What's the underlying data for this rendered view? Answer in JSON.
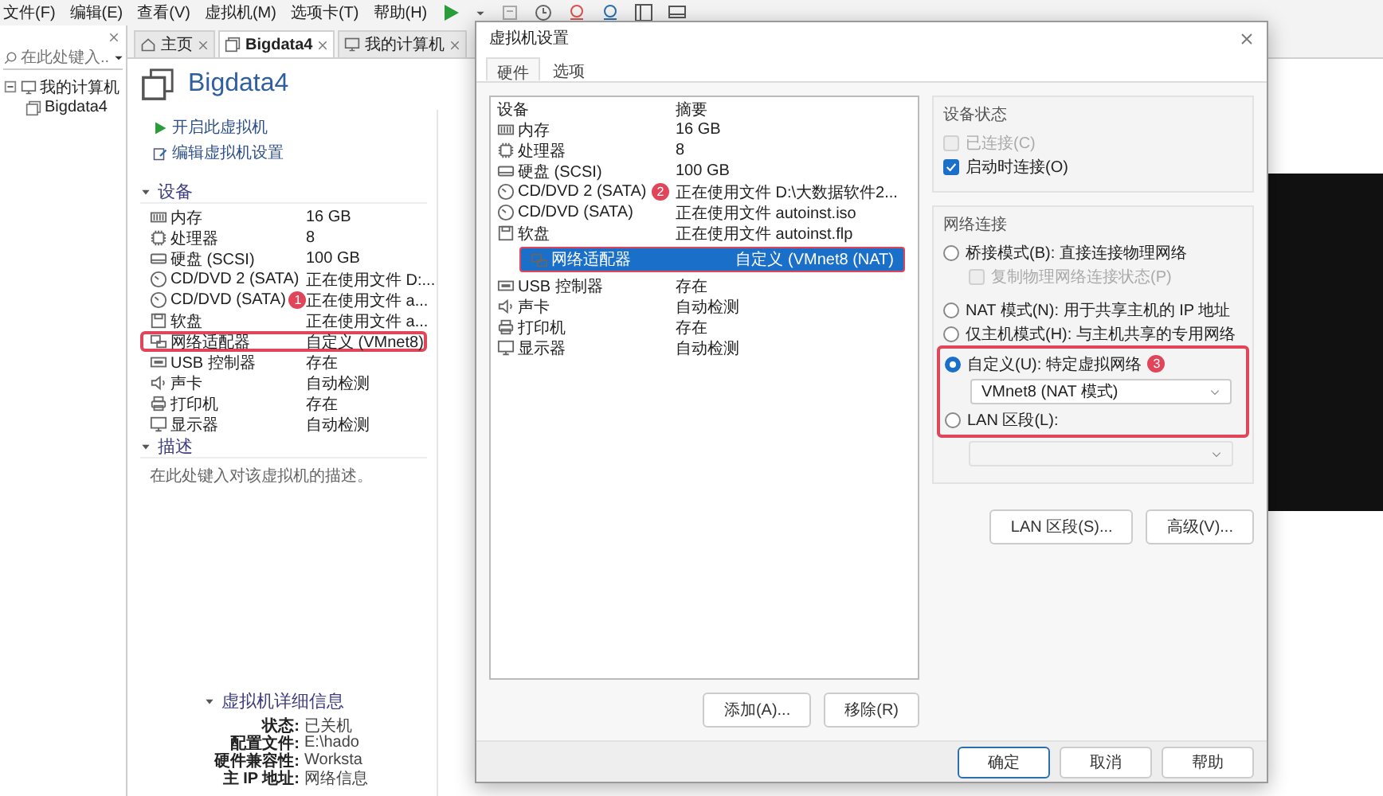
{
  "menu": [
    "文件(F)",
    "编辑(E)",
    "查看(V)",
    "虚拟机(M)",
    "选项卡(T)",
    "帮助(H)"
  ],
  "library": {
    "search_placeholder": "在此处键入...",
    "tree": [
      {
        "label": "我的计算机",
        "expanded": true,
        "children": [
          {
            "label": "Bigdata4"
          }
        ]
      }
    ]
  },
  "tabs": [
    {
      "kind": "home",
      "label": "主页",
      "selected": false
    },
    {
      "kind": "vm",
      "label": "Bigdata4",
      "selected": true
    },
    {
      "kind": "host",
      "label": "我的计算机",
      "selected": false
    }
  ],
  "vm": {
    "title": "Bigdata4",
    "actions": [
      {
        "kind": "power_on",
        "label": "开启此虚拟机"
      },
      {
        "kind": "edit",
        "label": "编辑虚拟机设置"
      }
    ],
    "devices_section": {
      "heading": "设备",
      "expanded": true,
      "rows": [
        {
          "kind": "memory",
          "name": "内存",
          "summary": "16 GB",
          "highlighted": false
        },
        {
          "kind": "cpu",
          "name": "处理器",
          "summary": "8",
          "highlighted": false
        },
        {
          "kind": "disk",
          "name": "硬盘 (SCSI)",
          "summary": "100 GB",
          "highlighted": false
        },
        {
          "kind": "cd",
          "name": "CD/DVD 2 (SATA)",
          "summary": "正在使用文件 D:...",
          "highlighted": false
        },
        {
          "kind": "cd",
          "name": "CD/DVD (SATA)",
          "summary": "正在使用文件 a...",
          "highlighted": false,
          "badge": "1"
        },
        {
          "kind": "floppy",
          "name": "软盘",
          "summary": "正在使用文件 a...",
          "highlighted": false
        },
        {
          "kind": "network",
          "name": "网络适配器",
          "summary": "自定义 (VMnet8)",
          "highlighted": true
        },
        {
          "kind": "usb",
          "name": "USB 控制器",
          "summary": "存在",
          "highlighted": false
        },
        {
          "kind": "sound",
          "name": "声卡",
          "summary": "自动检测",
          "highlighted": false
        },
        {
          "kind": "printer",
          "name": "打印机",
          "summary": "存在",
          "highlighted": false
        },
        {
          "kind": "display",
          "name": "显示器",
          "summary": "自动检测",
          "highlighted": false
        }
      ]
    },
    "description_section": {
      "heading": "描述",
      "expanded": true,
      "placeholder": "在此处键入对该虚拟机的描述。"
    },
    "details_section": {
      "heading": "虚拟机详细信息",
      "expanded": true,
      "rows": [
        {
          "label": "状态:",
          "value": "已关机"
        },
        {
          "label": "配置文件:",
          "value": "E:\\hado"
        },
        {
          "label": "硬件兼容性:",
          "value": "Worksta"
        },
        {
          "label": "主 IP 地址:",
          "value": "网络信息"
        }
      ]
    }
  },
  "dialog": {
    "title": "虚拟机设置",
    "tabs": [
      {
        "label": "硬件",
        "selected": true
      },
      {
        "label": "选项",
        "selected": false
      }
    ],
    "devices": {
      "columns": [
        "设备",
        "摘要"
      ],
      "rows": [
        {
          "kind": "memory",
          "name": "内存",
          "summary": "16 GB",
          "selected": false,
          "highlighted": false
        },
        {
          "kind": "cpu",
          "name": "处理器",
          "summary": "8",
          "selected": false,
          "highlighted": false
        },
        {
          "kind": "disk",
          "name": "硬盘 (SCSI)",
          "summary": "100 GB",
          "selected": false,
          "highlighted": false
        },
        {
          "kind": "cd",
          "name": "CD/DVD 2 (SATA)",
          "summary": "正在使用文件 D:\\大数据软件2...",
          "selected": false,
          "highlighted": false,
          "badge": "2"
        },
        {
          "kind": "cd",
          "name": "CD/DVD (SATA)",
          "summary": "正在使用文件 autoinst.iso",
          "selected": false,
          "highlighted": false
        },
        {
          "kind": "floppy",
          "name": "软盘",
          "summary": "正在使用文件 autoinst.flp",
          "selected": false,
          "highlighted": false
        },
        {
          "kind": "network",
          "name": "网络适配器",
          "summary": "自定义 (VMnet8 (NAT)",
          "selected": true,
          "highlighted": true
        },
        {
          "kind": "usb",
          "name": "USB 控制器",
          "summary": "存在",
          "selected": false,
          "highlighted": false
        },
        {
          "kind": "sound",
          "name": "声卡",
          "summary": "自动检测",
          "selected": false,
          "highlighted": false
        },
        {
          "kind": "printer",
          "name": "打印机",
          "summary": "存在",
          "selected": false,
          "highlighted": false
        },
        {
          "kind": "display",
          "name": "显示器",
          "summary": "自动检测",
          "selected": false,
          "highlighted": false
        }
      ]
    },
    "list_buttons": [
      "添加(A)...",
      "移除(R)"
    ],
    "device_status": {
      "heading": "设备状态",
      "options": [
        {
          "kind": "checkbox",
          "label": "已连接(C)",
          "checked": false,
          "disabled": true
        },
        {
          "kind": "checkbox",
          "label": "启动时连接(O)",
          "checked": true,
          "disabled": false
        }
      ]
    },
    "network": {
      "heading": "网络连接",
      "options": [
        {
          "kind": "radio",
          "label": "桥接模式(B): 直接连接物理网络",
          "selected": false,
          "disabled": false,
          "highlighted": false,
          "children": [
            {
              "kind": "checkbox",
              "label": "复制物理网络连接状态(P)",
              "checked": false,
              "disabled": true
            }
          ]
        },
        {
          "kind": "radio",
          "label": "NAT 模式(N): 用于共享主机的 IP 地址",
          "selected": false,
          "disabled": false,
          "highlighted": false
        },
        {
          "kind": "radio",
          "label": "仅主机模式(H): 与主机共享的专用网络",
          "selected": false,
          "disabled": false,
          "highlighted": false
        },
        {
          "kind": "radio",
          "label": "自定义(U): 特定虚拟网络",
          "selected": true,
          "disabled": false,
          "highlighted": true,
          "badge": "3"
        },
        {
          "kind": "select",
          "value": "VMnet8 (NAT 模式)",
          "disabled": false,
          "highlighted": true
        },
        {
          "kind": "radio",
          "label": "LAN 区段(L):",
          "selected": false,
          "disabled": false,
          "highlighted": true
        },
        {
          "kind": "select",
          "disabled": true,
          "highlighted": false
        }
      ]
    },
    "network_buttons": [
      "LAN 区段(S)...",
      "高级(V)..."
    ],
    "footer_buttons": [
      {
        "label": "确定",
        "default": true
      },
      {
        "label": "取消",
        "default": false
      },
      {
        "label": "帮助",
        "default": false
      }
    ]
  }
}
